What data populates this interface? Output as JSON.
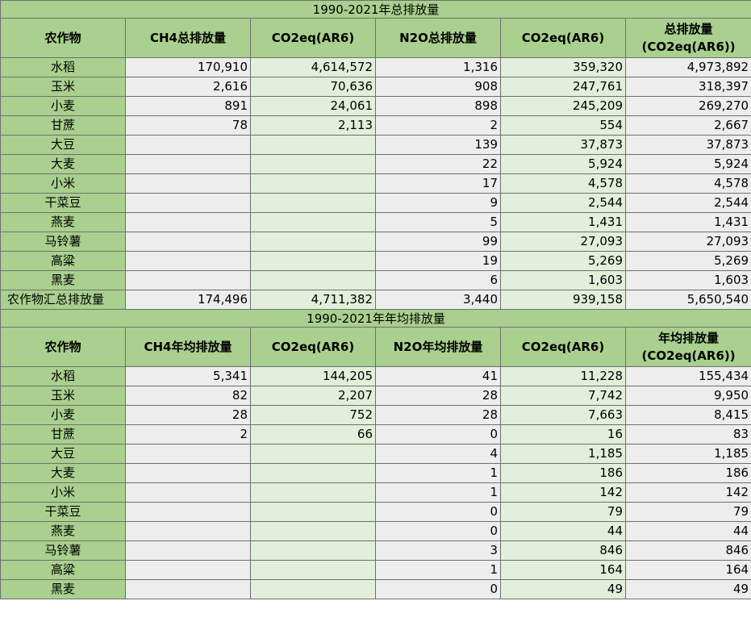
{
  "tables": [
    {
      "title": "1990-2021年总排放量",
      "headers": [
        "农作物",
        "CH4总排放量",
        "CO2eq(AR6)",
        "N2O总排放量",
        "CO2eq(AR6)",
        "总排放量\n(CO2eq(AR6))"
      ],
      "rows": [
        [
          "水稻",
          "170,910",
          "4,614,572",
          "1,316",
          "359,320",
          "4,973,892"
        ],
        [
          "玉米",
          "2,616",
          "70,636",
          "908",
          "247,761",
          "318,397"
        ],
        [
          "小麦",
          "891",
          "24,061",
          "898",
          "245,209",
          "269,270"
        ],
        [
          "甘蔗",
          "78",
          "2,113",
          "2",
          "554",
          "2,667"
        ],
        [
          "大豆",
          "",
          "",
          "139",
          "37,873",
          "37,873"
        ],
        [
          "大麦",
          "",
          "",
          "22",
          "5,924",
          "5,924"
        ],
        [
          "小米",
          "",
          "",
          "17",
          "4,578",
          "4,578"
        ],
        [
          "干菜豆",
          "",
          "",
          "9",
          "2,544",
          "2,544"
        ],
        [
          "燕麦",
          "",
          "",
          "5",
          "1,431",
          "1,431"
        ],
        [
          "马铃薯",
          "",
          "",
          "99",
          "27,093",
          "27,093"
        ],
        [
          "高粱",
          "",
          "",
          "19",
          "5,269",
          "5,269"
        ],
        [
          "黑麦",
          "",
          "",
          "6",
          "1,603",
          "1,603"
        ],
        [
          "农作物汇总排放量",
          "174,496",
          "4,711,382",
          "3,440",
          "939,158",
          "5,650,540"
        ]
      ]
    },
    {
      "title": "1990-2021年年均排放量",
      "headers": [
        "农作物",
        "CH4年均排放量",
        "CO2eq(AR6)",
        "N2O年均排放量",
        "CO2eq(AR6)",
        "年均排放量\n(CO2eq(AR6))"
      ],
      "rows": [
        [
          "水稻",
          "5,341",
          "144,205",
          "41",
          "11,228",
          "155,434"
        ],
        [
          "玉米",
          "82",
          "2,207",
          "28",
          "7,742",
          "9,950"
        ],
        [
          "小麦",
          "28",
          "752",
          "28",
          "7,663",
          "8,415"
        ],
        [
          "甘蔗",
          "2",
          "66",
          "0",
          "16",
          "83"
        ],
        [
          "大豆",
          "",
          "",
          "4",
          "1,185",
          "1,185"
        ],
        [
          "大麦",
          "",
          "",
          "1",
          "186",
          "186"
        ],
        [
          "小米",
          "",
          "",
          "1",
          "142",
          "142"
        ],
        [
          "干菜豆",
          "",
          "",
          "0",
          "79",
          "79"
        ],
        [
          "燕麦",
          "",
          "",
          "0",
          "44",
          "44"
        ],
        [
          "马铃薯",
          "",
          "",
          "3",
          "846",
          "846"
        ],
        [
          "高粱",
          "",
          "",
          "1",
          "164",
          "164"
        ],
        [
          "黑麦",
          "",
          "",
          "0",
          "49",
          "49"
        ]
      ]
    }
  ],
  "colors": {
    "header_green": "#a9d08e",
    "cell_gray": "#ededed",
    "cell_light_green": "#e2efda",
    "grid_line": "#6f6f6f"
  }
}
